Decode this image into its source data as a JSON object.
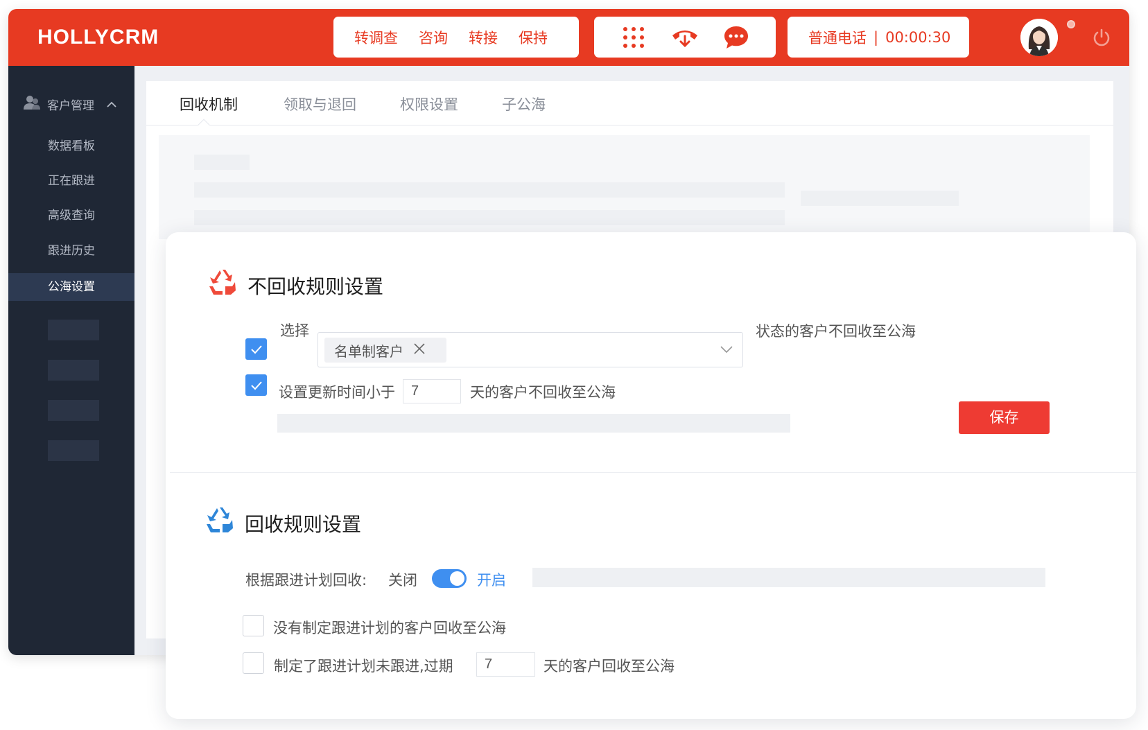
{
  "app": {
    "brand": "HOLLYCRM"
  },
  "header": {
    "actions": [
      "转调查",
      "咨询",
      "转接",
      "保持"
    ],
    "icons": [
      "dialpad-icon",
      "hangup-icon",
      "chat-icon"
    ],
    "call_type": "普通电话",
    "call_separator": "|",
    "call_timer": "00:00:30"
  },
  "sidebar": {
    "group_label": "客户管理",
    "items": [
      "数据看板",
      "正在跟进",
      "高级查询",
      "跟进历史",
      "公海设置"
    ],
    "active_item": "公海设置"
  },
  "tabs": [
    "回收机制",
    "领取与退回",
    "权限设置",
    "子公海"
  ],
  "active_tab": "回收机制",
  "no_recycle": {
    "title": "不回收规则设置",
    "select_label": "选择",
    "selected_tag": "名单制客户",
    "select_suffix": "状态的客户不回收至公海",
    "update_prefix": "设置更新时间小于",
    "update_days": "7",
    "update_suffix": "天的客户不回收至公海",
    "checkbox1_checked": true,
    "checkbox2_checked": true,
    "save_label": "保存"
  },
  "recycle": {
    "title": "回收规则设置",
    "plan_label": "根据跟进计划回收:",
    "off_label": "关闭",
    "on_label": "开启",
    "switch_on": true,
    "option1": "没有制定跟进计划的客户回收至公海",
    "option2_prefix": "制定了跟进计划未跟进,过期",
    "option2_days": "7",
    "option2_suffix": "天的客户回收至公海"
  },
  "colors": {
    "brand_red": "#e73a22",
    "sidebar_bg": "#1f2735",
    "accent_blue": "#3f8ff0",
    "save_red": "#ee3b33"
  }
}
